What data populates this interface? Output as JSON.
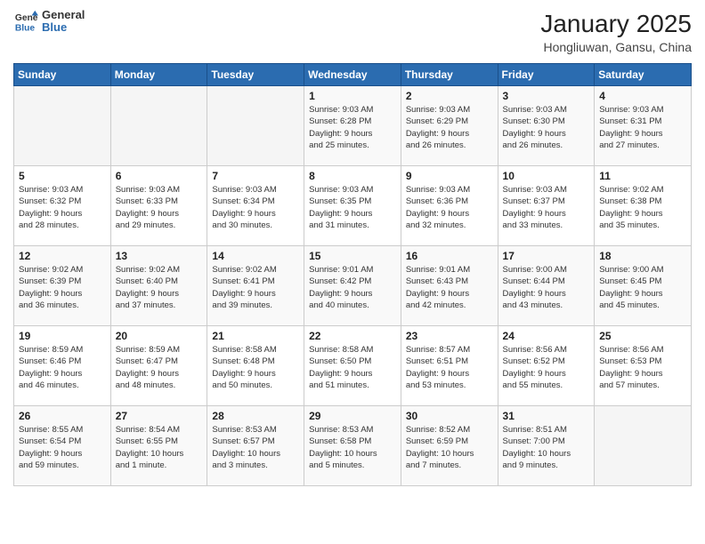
{
  "header": {
    "logo_line1": "General",
    "logo_line2": "Blue",
    "month": "January 2025",
    "location": "Hongliuwan, Gansu, China"
  },
  "weekdays": [
    "Sunday",
    "Monday",
    "Tuesday",
    "Wednesday",
    "Thursday",
    "Friday",
    "Saturday"
  ],
  "weeks": [
    [
      {
        "day": "",
        "info": ""
      },
      {
        "day": "",
        "info": ""
      },
      {
        "day": "",
        "info": ""
      },
      {
        "day": "1",
        "info": "Sunrise: 9:03 AM\nSunset: 6:28 PM\nDaylight: 9 hours\nand 25 minutes."
      },
      {
        "day": "2",
        "info": "Sunrise: 9:03 AM\nSunset: 6:29 PM\nDaylight: 9 hours\nand 26 minutes."
      },
      {
        "day": "3",
        "info": "Sunrise: 9:03 AM\nSunset: 6:30 PM\nDaylight: 9 hours\nand 26 minutes."
      },
      {
        "day": "4",
        "info": "Sunrise: 9:03 AM\nSunset: 6:31 PM\nDaylight: 9 hours\nand 27 minutes."
      }
    ],
    [
      {
        "day": "5",
        "info": "Sunrise: 9:03 AM\nSunset: 6:32 PM\nDaylight: 9 hours\nand 28 minutes."
      },
      {
        "day": "6",
        "info": "Sunrise: 9:03 AM\nSunset: 6:33 PM\nDaylight: 9 hours\nand 29 minutes."
      },
      {
        "day": "7",
        "info": "Sunrise: 9:03 AM\nSunset: 6:34 PM\nDaylight: 9 hours\nand 30 minutes."
      },
      {
        "day": "8",
        "info": "Sunrise: 9:03 AM\nSunset: 6:35 PM\nDaylight: 9 hours\nand 31 minutes."
      },
      {
        "day": "9",
        "info": "Sunrise: 9:03 AM\nSunset: 6:36 PM\nDaylight: 9 hours\nand 32 minutes."
      },
      {
        "day": "10",
        "info": "Sunrise: 9:03 AM\nSunset: 6:37 PM\nDaylight: 9 hours\nand 33 minutes."
      },
      {
        "day": "11",
        "info": "Sunrise: 9:02 AM\nSunset: 6:38 PM\nDaylight: 9 hours\nand 35 minutes."
      }
    ],
    [
      {
        "day": "12",
        "info": "Sunrise: 9:02 AM\nSunset: 6:39 PM\nDaylight: 9 hours\nand 36 minutes."
      },
      {
        "day": "13",
        "info": "Sunrise: 9:02 AM\nSunset: 6:40 PM\nDaylight: 9 hours\nand 37 minutes."
      },
      {
        "day": "14",
        "info": "Sunrise: 9:02 AM\nSunset: 6:41 PM\nDaylight: 9 hours\nand 39 minutes."
      },
      {
        "day": "15",
        "info": "Sunrise: 9:01 AM\nSunset: 6:42 PM\nDaylight: 9 hours\nand 40 minutes."
      },
      {
        "day": "16",
        "info": "Sunrise: 9:01 AM\nSunset: 6:43 PM\nDaylight: 9 hours\nand 42 minutes."
      },
      {
        "day": "17",
        "info": "Sunrise: 9:00 AM\nSunset: 6:44 PM\nDaylight: 9 hours\nand 43 minutes."
      },
      {
        "day": "18",
        "info": "Sunrise: 9:00 AM\nSunset: 6:45 PM\nDaylight: 9 hours\nand 45 minutes."
      }
    ],
    [
      {
        "day": "19",
        "info": "Sunrise: 8:59 AM\nSunset: 6:46 PM\nDaylight: 9 hours\nand 46 minutes."
      },
      {
        "day": "20",
        "info": "Sunrise: 8:59 AM\nSunset: 6:47 PM\nDaylight: 9 hours\nand 48 minutes."
      },
      {
        "day": "21",
        "info": "Sunrise: 8:58 AM\nSunset: 6:48 PM\nDaylight: 9 hours\nand 50 minutes."
      },
      {
        "day": "22",
        "info": "Sunrise: 8:58 AM\nSunset: 6:50 PM\nDaylight: 9 hours\nand 51 minutes."
      },
      {
        "day": "23",
        "info": "Sunrise: 8:57 AM\nSunset: 6:51 PM\nDaylight: 9 hours\nand 53 minutes."
      },
      {
        "day": "24",
        "info": "Sunrise: 8:56 AM\nSunset: 6:52 PM\nDaylight: 9 hours\nand 55 minutes."
      },
      {
        "day": "25",
        "info": "Sunrise: 8:56 AM\nSunset: 6:53 PM\nDaylight: 9 hours\nand 57 minutes."
      }
    ],
    [
      {
        "day": "26",
        "info": "Sunrise: 8:55 AM\nSunset: 6:54 PM\nDaylight: 9 hours\nand 59 minutes."
      },
      {
        "day": "27",
        "info": "Sunrise: 8:54 AM\nSunset: 6:55 PM\nDaylight: 10 hours\nand 1 minute."
      },
      {
        "day": "28",
        "info": "Sunrise: 8:53 AM\nSunset: 6:57 PM\nDaylight: 10 hours\nand 3 minutes."
      },
      {
        "day": "29",
        "info": "Sunrise: 8:53 AM\nSunset: 6:58 PM\nDaylight: 10 hours\nand 5 minutes."
      },
      {
        "day": "30",
        "info": "Sunrise: 8:52 AM\nSunset: 6:59 PM\nDaylight: 10 hours\nand 7 minutes."
      },
      {
        "day": "31",
        "info": "Sunrise: 8:51 AM\nSunset: 7:00 PM\nDaylight: 10 hours\nand 9 minutes."
      },
      {
        "day": "",
        "info": ""
      }
    ]
  ]
}
